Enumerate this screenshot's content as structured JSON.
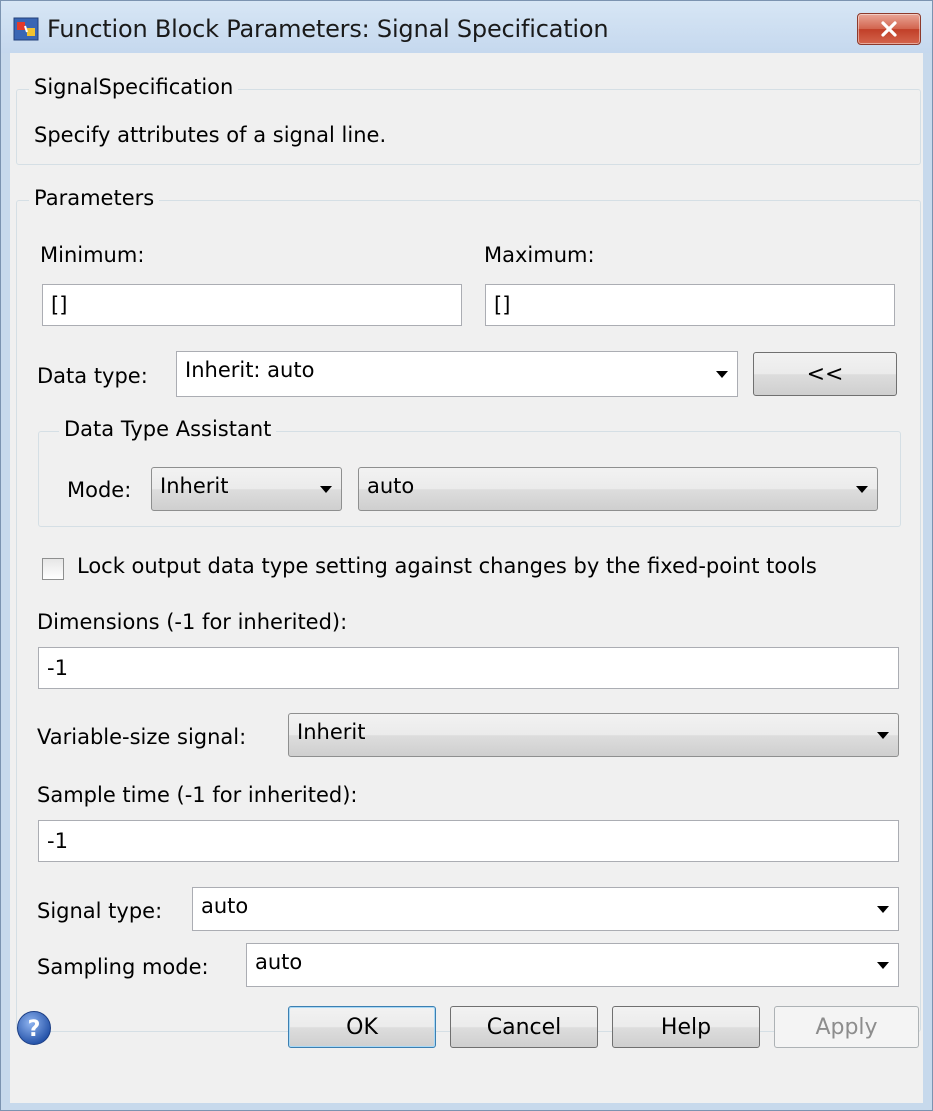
{
  "window": {
    "title": "Function Block Parameters: Signal Specification"
  },
  "description_group": {
    "legend": "SignalSpecification",
    "text": "Specify attributes of a signal line."
  },
  "parameters": {
    "legend": "Parameters",
    "minimum_label": "Minimum:",
    "minimum_value": "[]",
    "maximum_label": "Maximum:",
    "maximum_value": "[]",
    "data_type_label": "Data type:",
    "data_type_value": "Inherit: auto",
    "toggle_assistant_label": "<<",
    "assistant": {
      "legend": "Data Type Assistant",
      "mode_label": "Mode:",
      "mode_value": "Inherit",
      "rule_value": "auto"
    },
    "lock_label": "Lock output data type setting against changes by the fixed-point tools",
    "lock_checked": false,
    "dimensions_label": "Dimensions (-1 for inherited):",
    "dimensions_value": "-1",
    "variable_size_label": "Variable-size signal:",
    "variable_size_value": "Inherit",
    "sample_time_label": "Sample time (-1 for inherited):",
    "sample_time_value": "-1",
    "signal_type_label": "Signal type:",
    "signal_type_value": "auto",
    "sampling_mode_label": "Sampling mode:",
    "sampling_mode_value": "auto"
  },
  "buttons": {
    "ok": "OK",
    "cancel": "Cancel",
    "help": "Help",
    "apply": "Apply"
  },
  "colors": {
    "title_bar": "#c7d9ec",
    "dialog_bg": "#f0f0f0",
    "close_button": "#c7432b",
    "default_button_border": "#3c7fb1"
  }
}
